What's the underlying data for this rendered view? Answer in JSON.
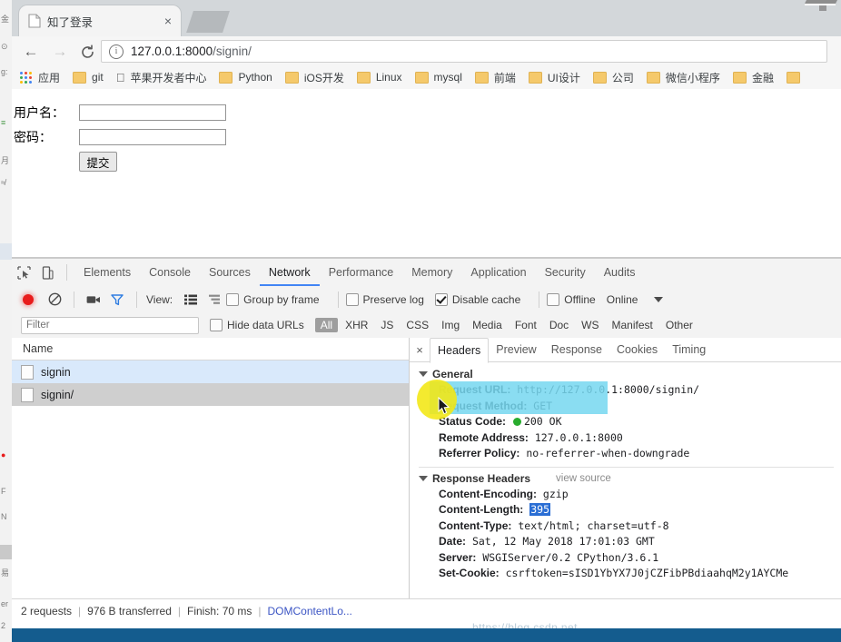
{
  "browser": {
    "tab": {
      "title": "知了登录",
      "favicon": "page-icon",
      "close": "×"
    },
    "nav": {
      "back": "←",
      "forward": "→",
      "reload": "⟳",
      "info_icon": "i"
    },
    "omnibox": {
      "host": "127.0.0.1:8000",
      "path": "/signin/",
      "full_url": "127.0.0.1:8000/signin/"
    },
    "bookmarks": [
      {
        "label": "应用",
        "icon": "apps-grid-icon"
      },
      {
        "label": "git",
        "icon": "folder-icon"
      },
      {
        "label": "",
        "icon": "apple-icon"
      },
      {
        "label": "苹果开发者中心",
        "icon": "none"
      },
      {
        "label": "Python",
        "icon": "folder-icon"
      },
      {
        "label": "iOS开发",
        "icon": "folder-icon"
      },
      {
        "label": "Linux",
        "icon": "folder-icon"
      },
      {
        "label": "mysql",
        "icon": "folder-icon"
      },
      {
        "label": "前端",
        "icon": "folder-icon"
      },
      {
        "label": "UI设计",
        "icon": "folder-icon"
      },
      {
        "label": "公司",
        "icon": "folder-icon"
      },
      {
        "label": "微信小程序",
        "icon": "folder-icon"
      },
      {
        "label": "金融",
        "icon": "folder-icon"
      }
    ]
  },
  "page": {
    "username_label": "用户名：",
    "username_value": "",
    "password_label": "密码：",
    "password_value": "",
    "submit_label": "提交"
  },
  "devtools": {
    "tabs": [
      {
        "label": "Elements",
        "active": false
      },
      {
        "label": "Console",
        "active": false
      },
      {
        "label": "Sources",
        "active": false
      },
      {
        "label": "Network",
        "active": true
      },
      {
        "label": "Performance",
        "active": false
      },
      {
        "label": "Memory",
        "active": false
      },
      {
        "label": "Application",
        "active": false
      },
      {
        "label": "Security",
        "active": false
      },
      {
        "label": "Audits",
        "active": false
      }
    ],
    "network_toolbar": {
      "record_title": "record-button",
      "clear_title": "clear-button",
      "capture_screenshots_title": "camera-button",
      "filter_title": "filter-button",
      "view_label": "View:",
      "group_by_frame": {
        "label": "Group by frame",
        "checked": false
      },
      "preserve_log": {
        "label": "Preserve log",
        "checked": false
      },
      "disable_cache": {
        "label": "Disable cache",
        "checked": true
      },
      "offline": {
        "label": "Offline",
        "checked": false
      },
      "online": "Online"
    },
    "filter_row": {
      "placeholder": "Filter",
      "value": "",
      "hide_data_urls": {
        "label": "Hide data URLs",
        "checked": false
      },
      "types": [
        {
          "label": "All",
          "selected": true
        },
        {
          "label": "XHR",
          "selected": false
        },
        {
          "label": "JS",
          "selected": false
        },
        {
          "label": "CSS",
          "selected": false
        },
        {
          "label": "Img",
          "selected": false
        },
        {
          "label": "Media",
          "selected": false
        },
        {
          "label": "Font",
          "selected": false
        },
        {
          "label": "Doc",
          "selected": false
        },
        {
          "label": "WS",
          "selected": false
        },
        {
          "label": "Manifest",
          "selected": false
        },
        {
          "label": "Other",
          "selected": false
        }
      ]
    },
    "requests": {
      "column_header": "Name",
      "rows": [
        {
          "name": "signin",
          "state": "selected"
        },
        {
          "name": "signin/",
          "state": "hovered"
        }
      ]
    },
    "details": {
      "close": "×",
      "tabs": [
        {
          "label": "Headers",
          "active": true
        },
        {
          "label": "Preview",
          "active": false
        },
        {
          "label": "Response",
          "active": false
        },
        {
          "label": "Cookies",
          "active": false
        },
        {
          "label": "Timing",
          "active": false
        }
      ],
      "general": {
        "title": "General",
        "rows": [
          {
            "key": "Request URL:",
            "value": "http://127.0.0.1:8000/signin/"
          },
          {
            "key": "Request Method:",
            "value": "GET"
          },
          {
            "key": "Status Code:",
            "value": "200 OK",
            "status_dot": "#29ac2e"
          },
          {
            "key": "Remote Address:",
            "value": "127.0.0.1:8000"
          },
          {
            "key": "Referrer Policy:",
            "value": "no-referrer-when-downgrade"
          }
        ]
      },
      "response_headers": {
        "title": "Response Headers",
        "view_source": "view source",
        "rows": [
          {
            "key": "Content-Encoding:",
            "value": "gzip"
          },
          {
            "key": "Content-Length:",
            "value": "395",
            "value_selected": true
          },
          {
            "key": "Content-Type:",
            "value": "text/html; charset=utf-8"
          },
          {
            "key": "Date:",
            "value": "Sat, 12 May 2018 17:01:03 GMT"
          },
          {
            "key": "Server:",
            "value": "WSGIServer/0.2 CPython/3.6.1"
          },
          {
            "key": "Set-Cookie:",
            "value": "csrftoken=sISD1YbYX7J0jCZFibPBdiaahqM2y1AYCMe"
          }
        ]
      }
    },
    "statusbar": {
      "requests": "2 requests",
      "transferred": "976 B transferred",
      "finish": "Finish: 70 ms",
      "domcontentloaded": "DOMContentLo..."
    }
  },
  "colors": {
    "accent": "#4285f4",
    "record": "#e81c1c",
    "status_ok": "#29ac2e",
    "selection_band": "#76d7f0",
    "selection_text": "#2a6ed4",
    "cursor_highlight": "#f2e712",
    "link": "#3b55c4"
  },
  "watermark": "https://blog.csdn.net"
}
